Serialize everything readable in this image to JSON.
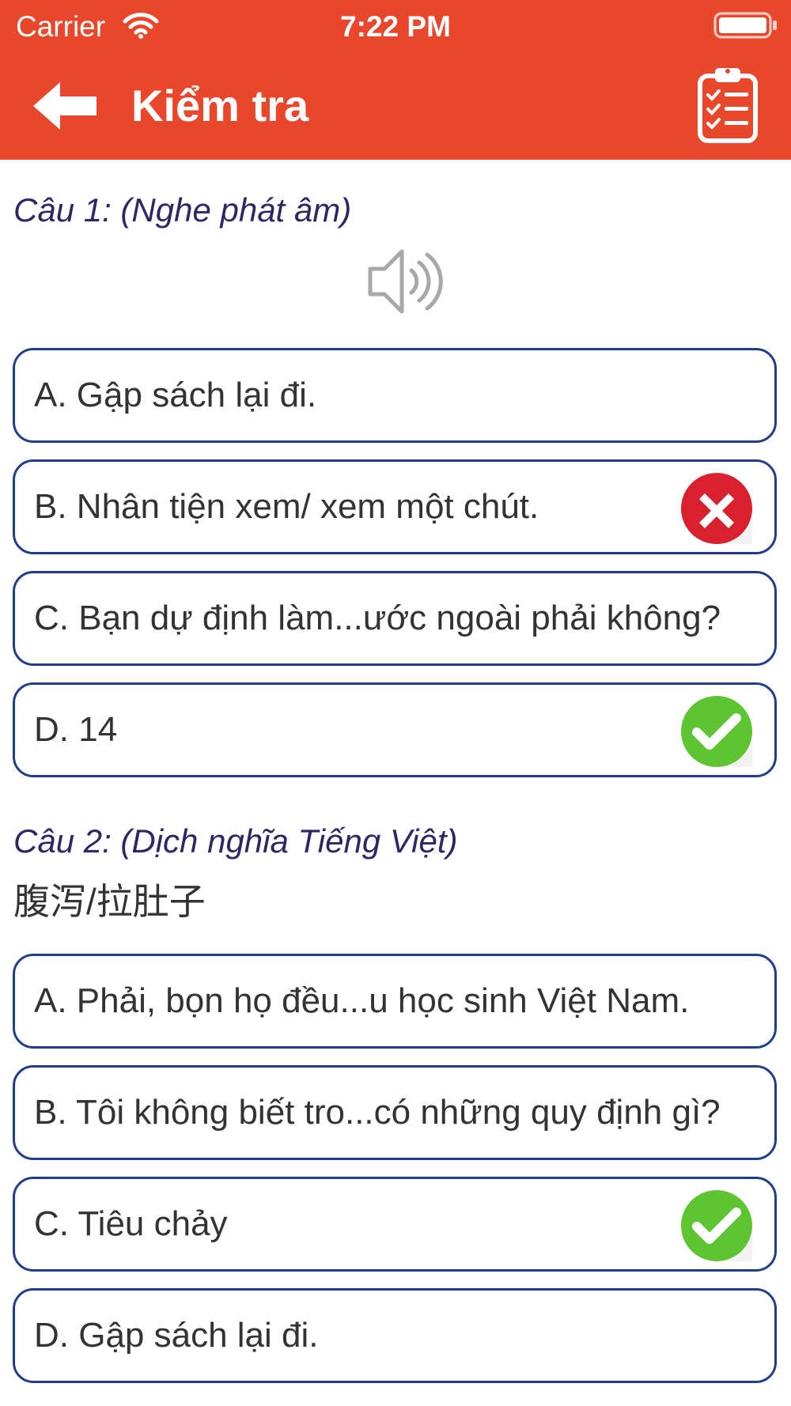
{
  "status_bar": {
    "carrier": "Carrier",
    "time": "7:22 PM"
  },
  "nav": {
    "title": "Kiểm tra",
    "back_icon": "back-arrow-icon",
    "action_icon": "clipboard-checklist-icon"
  },
  "colors": {
    "header": "#e9472b",
    "option_border": "#1f3f8c",
    "question_title": "#2e2665",
    "correct": "#5cc531",
    "wrong": "#d8202e"
  },
  "questions": [
    {
      "title": "Câu 1: (Nghe phát âm)",
      "media_icon": "speaker-icon",
      "options": [
        {
          "label": "A. Gập sách lại đi.",
          "mark": "none"
        },
        {
          "label": "B. Nhân tiện xem/ xem một chút.",
          "mark": "wrong"
        },
        {
          "label": "C. Bạn dự định làm...ước ngoài phải không?",
          "mark": "none"
        },
        {
          "label": "D. 14",
          "mark": "correct"
        }
      ]
    },
    {
      "title": "Câu 2: (Dịch nghĩa Tiếng Việt)",
      "prompt": "腹泻/拉肚子",
      "options": [
        {
          "label": "A. Phải, bọn họ đều...u học sinh Việt Nam.",
          "mark": "none"
        },
        {
          "label": "B. Tôi không biết tro...có những quy định gì?",
          "mark": "none"
        },
        {
          "label": "C. Tiêu chảy",
          "mark": "correct"
        },
        {
          "label": "D. Gập sách lại đi.",
          "mark": "none"
        }
      ]
    }
  ]
}
